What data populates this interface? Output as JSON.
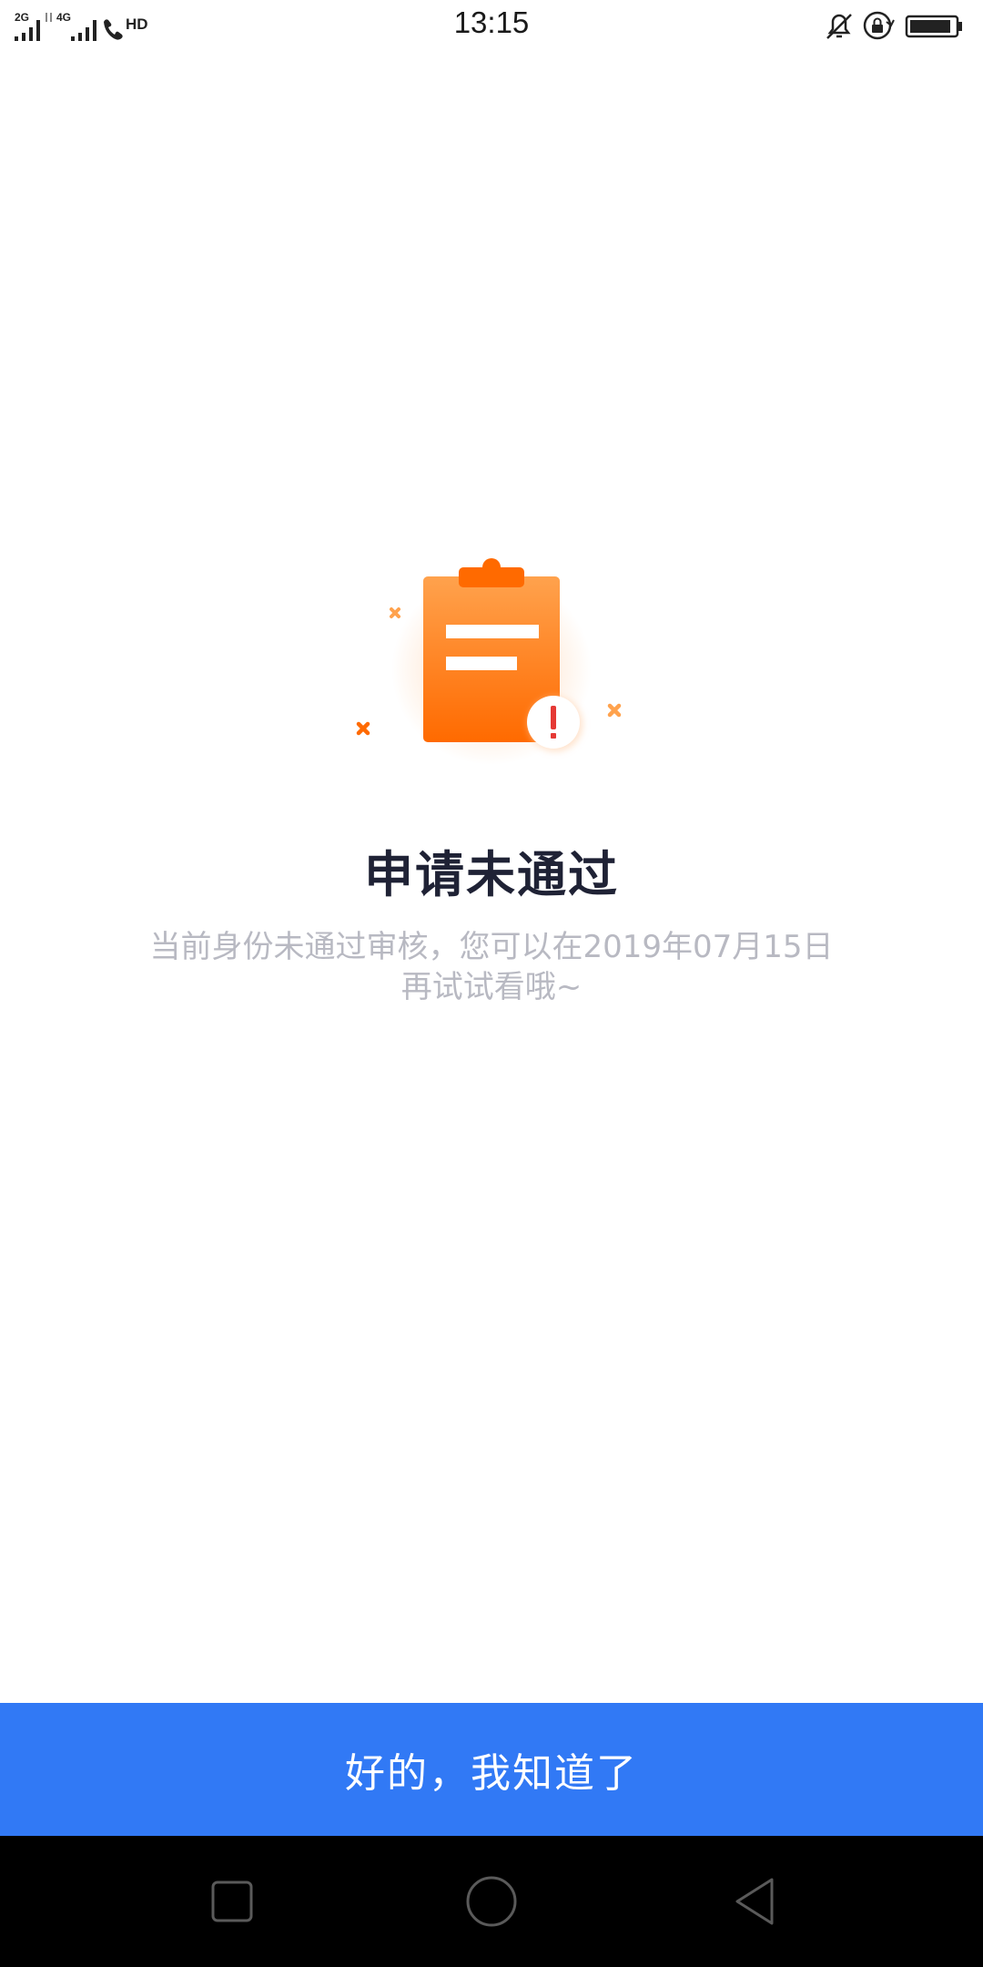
{
  "status_bar": {
    "time": "13:15",
    "left_icons": [
      "2G",
      "4G",
      "HD"
    ],
    "right_icons": [
      "bell-muted-icon",
      "rotation-lock-icon",
      "battery-icon"
    ]
  },
  "result": {
    "title": "申请未通过",
    "description_line1": "当前身份未通过审核，您可以在2019年07月15日",
    "description_line2": "再试试看哦~",
    "illustration": "clipboard-warning-icon"
  },
  "actions": {
    "confirm_label": "好的，我知道了"
  },
  "colors": {
    "primary": "#3179f5",
    "accent": "#ff6a00",
    "warning": "#e53935",
    "title_text": "#1f2235",
    "muted_text": "#b8b9c2"
  },
  "nav_bar": {
    "buttons": [
      "recent-apps",
      "home",
      "back"
    ]
  }
}
